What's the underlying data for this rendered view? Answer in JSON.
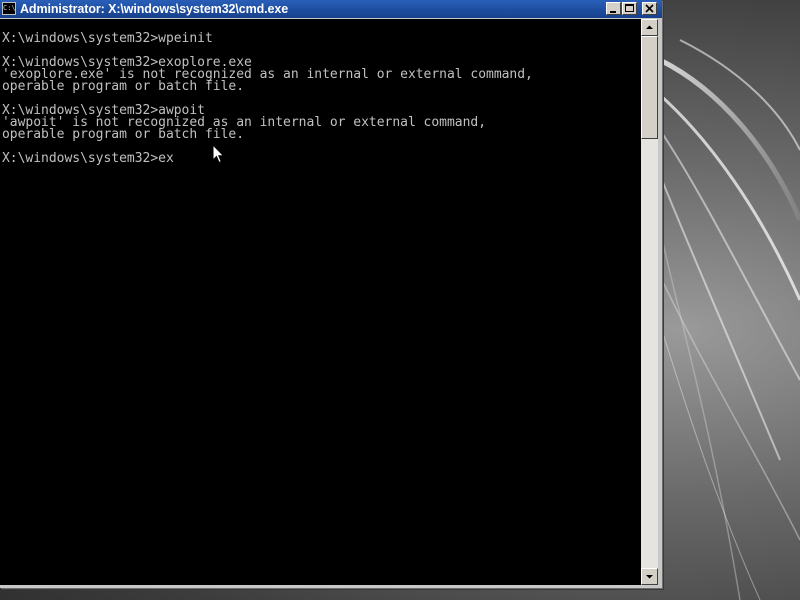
{
  "window": {
    "title": "Administrator: X:\\windows\\system32\\cmd.exe",
    "icon_label": "C:\\"
  },
  "console": {
    "lines": [
      "X:\\windows\\system32>wpeinit",
      "",
      "X:\\windows\\system32>exoplore.exe",
      "'exoplore.exe' is not recognized as an internal or external command,",
      "operable program or batch file.",
      "",
      "X:\\windows\\system32>awpoit",
      "'awpoit' is not recognized as an internal or external command,",
      "operable program or batch file.",
      "",
      "X:\\windows\\system32>ex"
    ],
    "text_color": "#c0c0c0",
    "background_color": "#000000"
  },
  "icons": {
    "minimize": "minimize-icon",
    "maximize": "maximize-icon",
    "close": "close-icon",
    "scroll_up": "arrow-up-icon",
    "scroll_down": "arrow-down-icon",
    "pointer": "mouse-pointer-icon"
  },
  "colors": {
    "titlebar": "#1f4fa3",
    "window_frame": "#c8c8c8"
  }
}
